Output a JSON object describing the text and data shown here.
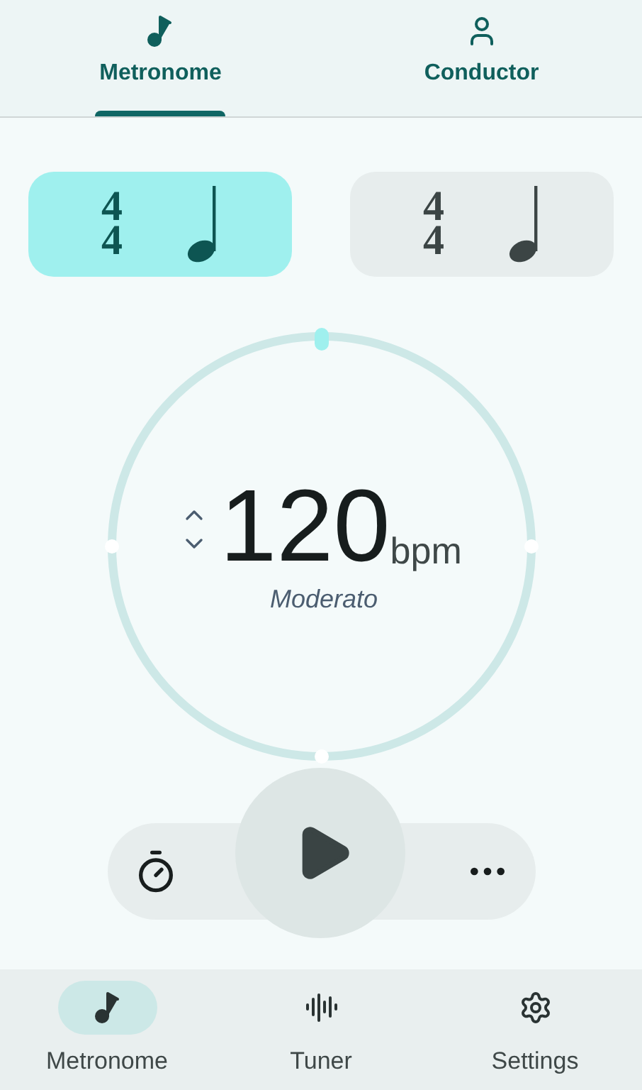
{
  "tabs": [
    {
      "label": "Metronome",
      "kind": "note",
      "selected": true
    },
    {
      "label": "Conductor",
      "kind": "person",
      "selected": false
    }
  ],
  "presets": [
    {
      "numerator": "4",
      "denominator": "4",
      "selected": true
    },
    {
      "numerator": "4",
      "denominator": "4",
      "selected": false
    }
  ],
  "tempo": {
    "value": "120",
    "unit": "bpm",
    "marking": "Moderato"
  },
  "bottom_nav": [
    {
      "label": "Metronome",
      "kind": "note",
      "selected": true
    },
    {
      "label": "Tuner",
      "kind": "wave",
      "selected": false
    },
    {
      "label": "Settings",
      "kind": "gear",
      "selected": false
    }
  ]
}
